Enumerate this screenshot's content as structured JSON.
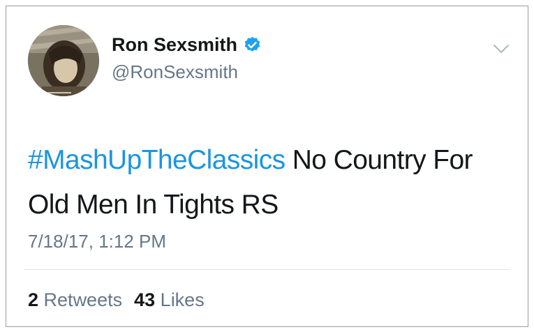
{
  "author": {
    "display_name": "Ron Sexsmith",
    "handle": "@RonSexsmith",
    "verified": true,
    "avatar_icon": "profile-photo"
  },
  "menu": {
    "icon": "chevron-down-icon"
  },
  "tweet": {
    "hashtag": "#MashUpTheClassics",
    "text": " No Country For Old Men In Tights RS",
    "hashtag_color": "#1b95e0",
    "timestamp": "7/18/17, 1:12 PM"
  },
  "stats": {
    "retweets_count": "2",
    "retweets_label": "Retweets",
    "likes_count": "43",
    "likes_label": "Likes"
  },
  "colors": {
    "verified_badge": "#1da1f2",
    "secondary_text": "#657786",
    "primary_text": "#14171a"
  }
}
